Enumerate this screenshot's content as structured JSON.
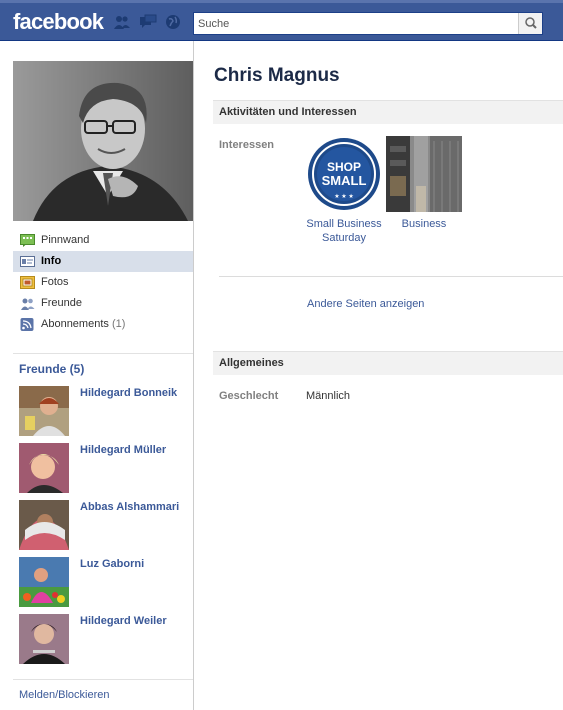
{
  "header": {
    "logo": "facebook",
    "search_placeholder": "Suche"
  },
  "sidebar": {
    "nav": [
      {
        "label": "Pinnwand",
        "icon": "wall-icon",
        "active": false
      },
      {
        "label": "Info",
        "icon": "info-icon",
        "active": true
      },
      {
        "label": "Fotos",
        "icon": "photos-icon",
        "active": false
      },
      {
        "label": "Freunde",
        "icon": "friends-icon",
        "active": false
      },
      {
        "label": "Abonnements",
        "icon": "subscriptions-icon",
        "count": "(1)",
        "active": false
      }
    ],
    "friends_title": "Freunde (5)",
    "friends": [
      {
        "name": "Hildegard Bonneik"
      },
      {
        "name": "Hildegard Müller"
      },
      {
        "name": "Abbas Alshammari"
      },
      {
        "name": "Luz Gaborni"
      },
      {
        "name": "Hildegard Weiler"
      }
    ],
    "report_link": "Melden/Blockieren"
  },
  "profile": {
    "name": "Chris Magnus",
    "activities_header": "Aktivitäten und Interessen",
    "interests_label": "Interessen",
    "interests": [
      {
        "caption": "Small Business Saturday",
        "badge_line1": "SHOP",
        "badge_line2": "SMALL"
      },
      {
        "caption": "Business"
      }
    ],
    "more_pages_link": "Andere Seiten anzeigen",
    "general_header": "Allgemeines",
    "gender_label": "Geschlecht",
    "gender_value": "Männlich"
  },
  "colors": {
    "brand_blue": "#3b5998",
    "active_nav": "#d8dfea",
    "section_bg": "#f2f2f2"
  }
}
